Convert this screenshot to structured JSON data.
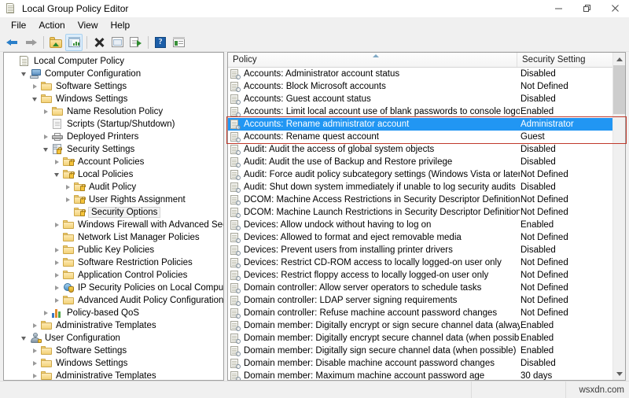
{
  "window": {
    "title": "Local Group Policy Editor",
    "icon": "mmc-console-icon",
    "buttons": {
      "minimize": "—",
      "maximize": "❐",
      "close": "✕"
    }
  },
  "menu": {
    "items": [
      "File",
      "Action",
      "View",
      "Help"
    ]
  },
  "toolbar": {
    "items": [
      {
        "name": "back-button",
        "icon": "arrow-back-icon",
        "active": false
      },
      {
        "name": "forward-button",
        "icon": "arrow-forward-icon",
        "active": false
      },
      {
        "name": "up-one-level-button",
        "icon": "folder-up-icon",
        "active": false
      },
      {
        "name": "show-hide-console-tree-button",
        "icon": "console-tree-icon",
        "active": true
      },
      {
        "name": "delete-button",
        "icon": "delete-x-icon",
        "active": false
      },
      {
        "name": "properties-button",
        "icon": "properties-icon",
        "active": false
      },
      {
        "name": "export-list-button",
        "icon": "export-list-icon",
        "active": false
      },
      {
        "name": "help-button",
        "icon": "help-question-icon",
        "active": false
      },
      {
        "name": "view-options-button",
        "icon": "window-list-icon",
        "active": false
      }
    ]
  },
  "tree": {
    "root_label": "Local Computer Policy",
    "items": [
      {
        "label": "Local Computer Policy",
        "indent": 0,
        "twist": "none",
        "icon": "mmc-console-icon"
      },
      {
        "label": "Computer Configuration",
        "indent": 1,
        "twist": "open",
        "icon": "computer-icon"
      },
      {
        "label": "Software Settings",
        "indent": 2,
        "twist": "closed",
        "icon": "folder-icon"
      },
      {
        "label": "Windows Settings",
        "indent": 2,
        "twist": "open",
        "icon": "folder-icon"
      },
      {
        "label": "Name Resolution Policy",
        "indent": 3,
        "twist": "closed",
        "icon": "folder-icon"
      },
      {
        "label": "Scripts (Startup/Shutdown)",
        "indent": 3,
        "twist": "none",
        "icon": "script-icon"
      },
      {
        "label": "Deployed Printers",
        "indent": 3,
        "twist": "closed",
        "icon": "printer-icon"
      },
      {
        "label": "Security Settings",
        "indent": 3,
        "twist": "open",
        "icon": "security-settings-icon"
      },
      {
        "label": "Account Policies",
        "indent": 4,
        "twist": "closed",
        "icon": "folder-lock-icon"
      },
      {
        "label": "Local Policies",
        "indent": 4,
        "twist": "open",
        "icon": "folder-lock-icon"
      },
      {
        "label": "Audit Policy",
        "indent": 5,
        "twist": "closed",
        "icon": "folder-lock-icon"
      },
      {
        "label": "User Rights Assignment",
        "indent": 5,
        "twist": "closed",
        "icon": "folder-lock-icon"
      },
      {
        "label": "Security Options",
        "indent": 5,
        "twist": "none",
        "icon": "folder-lock-icon",
        "selected": true
      },
      {
        "label": "Windows Firewall with Advanced Security",
        "indent": 4,
        "twist": "closed",
        "icon": "folder-icon"
      },
      {
        "label": "Network List Manager Policies",
        "indent": 4,
        "twist": "none",
        "icon": "folder-icon"
      },
      {
        "label": "Public Key Policies",
        "indent": 4,
        "twist": "closed",
        "icon": "folder-icon"
      },
      {
        "label": "Software Restriction Policies",
        "indent": 4,
        "twist": "closed",
        "icon": "folder-icon"
      },
      {
        "label": "Application Control Policies",
        "indent": 4,
        "twist": "closed",
        "icon": "folder-icon"
      },
      {
        "label": "IP Security Policies on Local Computer",
        "indent": 4,
        "twist": "closed",
        "icon": "ipsec-icon"
      },
      {
        "label": "Advanced Audit Policy Configuration",
        "indent": 4,
        "twist": "closed",
        "icon": "folder-icon"
      },
      {
        "label": "Policy-based QoS",
        "indent": 3,
        "twist": "closed",
        "icon": "qos-chart-icon"
      },
      {
        "label": "Administrative Templates",
        "indent": 2,
        "twist": "closed",
        "icon": "folder-icon"
      },
      {
        "label": "User Configuration",
        "indent": 1,
        "twist": "open",
        "icon": "user-icon"
      },
      {
        "label": "Software Settings",
        "indent": 2,
        "twist": "closed",
        "icon": "folder-icon"
      },
      {
        "label": "Windows Settings",
        "indent": 2,
        "twist": "closed",
        "icon": "folder-icon"
      },
      {
        "label": "Administrative Templates",
        "indent": 2,
        "twist": "closed",
        "icon": "folder-icon"
      }
    ]
  },
  "list": {
    "columns": [
      "Policy",
      "Security Setting"
    ],
    "sorted_column": "Policy",
    "sort_direction": "ascending",
    "rows": [
      {
        "policy": "Accounts: Administrator account status",
        "setting": "Disabled"
      },
      {
        "policy": "Accounts: Block Microsoft accounts",
        "setting": "Not Defined"
      },
      {
        "policy": "Accounts: Guest account status",
        "setting": "Disabled"
      },
      {
        "policy": "Accounts: Limit local account use of blank passwords to console logon only",
        "setting": "Enabled"
      },
      {
        "policy": "Accounts: Rename administrator account",
        "setting": "Administrator",
        "selected": true
      },
      {
        "policy": "Accounts: Rename quest account",
        "setting": "Guest"
      },
      {
        "policy": "Audit: Audit the access of global system objects",
        "setting": "Disabled"
      },
      {
        "policy": "Audit: Audit the use of Backup and Restore privilege",
        "setting": "Disabled"
      },
      {
        "policy": "Audit: Force audit policy subcategory settings (Windows Vista or later) to ov...",
        "setting": "Not Defined"
      },
      {
        "policy": "Audit: Shut down system immediately if unable to log security audits",
        "setting": "Disabled"
      },
      {
        "policy": "DCOM: Machine Access Restrictions in Security Descriptor Definition Langua...",
        "setting": "Not Defined"
      },
      {
        "policy": "DCOM: Machine Launch Restrictions in Security Descriptor Definition Langu...",
        "setting": "Not Defined"
      },
      {
        "policy": "Devices: Allow undock without having to log on",
        "setting": "Enabled"
      },
      {
        "policy": "Devices: Allowed to format and eject removable media",
        "setting": "Not Defined"
      },
      {
        "policy": "Devices: Prevent users from installing printer drivers",
        "setting": "Disabled"
      },
      {
        "policy": "Devices: Restrict CD-ROM access to locally logged-on user only",
        "setting": "Not Defined"
      },
      {
        "policy": "Devices: Restrict floppy access to locally logged-on user only",
        "setting": "Not Defined"
      },
      {
        "policy": "Domain controller: Allow server operators to schedule tasks",
        "setting": "Not Defined"
      },
      {
        "policy": "Domain controller: LDAP server signing requirements",
        "setting": "Not Defined"
      },
      {
        "policy": "Domain controller: Refuse machine account password changes",
        "setting": "Not Defined"
      },
      {
        "policy": "Domain member: Digitally encrypt or sign secure channel data (always)",
        "setting": "Enabled"
      },
      {
        "policy": "Domain member: Digitally encrypt secure channel data (when possible)",
        "setting": "Enabled"
      },
      {
        "policy": "Domain member: Digitally sign secure channel data (when possible)",
        "setting": "Enabled"
      },
      {
        "policy": "Domain member: Disable machine account password changes",
        "setting": "Disabled"
      },
      {
        "policy": "Domain member: Maximum machine account password age",
        "setting": "30 days"
      }
    ]
  },
  "annotation": {
    "highlight_color": "#c0392b",
    "selection_color": "#2196f3"
  },
  "statusbar": {
    "watermark": "wsxdn.com"
  }
}
